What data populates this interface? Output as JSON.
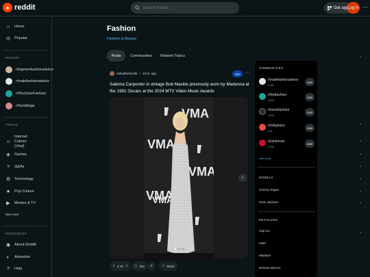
{
  "header": {
    "logo_text": "reddit",
    "search_placeholder": "Search Reddit",
    "get_app_label": "Get app",
    "login_label": "Log In",
    "more_label": "···"
  },
  "sidebar": {
    "nav": [
      {
        "label": "Home",
        "icon": "home-icon"
      },
      {
        "label": "Popular",
        "icon": "popular-icon"
      }
    ],
    "recent_label": "RECENT",
    "recent": [
      {
        "label": "r/bigmenfashionadvice",
        "color": "#c9b79c"
      },
      {
        "label": "r/malefashionadvice",
        "color": "#e6e6e6"
      },
      {
        "label": "r/PlusSizeFashion",
        "color": "#1ea79a"
      },
      {
        "label": "r/handbags",
        "color": "#d88b8b"
      }
    ],
    "topics_label": "TOPICS",
    "topics": [
      {
        "label": "Internet Culture (Viral)",
        "icon": "internet-culture-icon"
      },
      {
        "label": "Games",
        "icon": "games-icon"
      },
      {
        "label": "Q&As",
        "icon": "qa-icon"
      },
      {
        "label": "Technology",
        "icon": "technology-icon"
      },
      {
        "label": "Pop Culture",
        "icon": "pop-culture-icon"
      },
      {
        "label": "Movies & TV",
        "icon": "movies-tv-icon"
      }
    ],
    "see_more": "See more",
    "resources_label": "RESOURCES",
    "resources": [
      {
        "label": "About Reddit",
        "icon": "about-icon"
      },
      {
        "label": "Advertise",
        "icon": "advertise-icon"
      },
      {
        "label": "Help",
        "icon": "help-icon"
      }
    ]
  },
  "page": {
    "title": "Fashion",
    "subtitle": "Fashion & Beauty",
    "tabs": [
      "Posts",
      "Communities",
      "Related Topics"
    ]
  },
  "post": {
    "author": "r/whatthefrockk",
    "age": "10 hr. ago",
    "join_label": "Join",
    "more_label": "···",
    "title": "Sabrina Carpenter in vintage Bob Mackie previously worn by Madonna at the 1991 Oscars at the 2024 MTV Video Music Awards",
    "upvotes": "2.7K",
    "comments": "282",
    "share_label": "Share",
    "image_text": "VMA"
  },
  "right": {
    "communities_label": "COMMUNITIES",
    "communities": [
      {
        "name": "r/malefashionadvice",
        "count": "5.6M",
        "color": "#e6e6e6"
      },
      {
        "name": "r/findfashion",
        "count": "364K",
        "color": "#1ea79a"
      },
      {
        "name": "r/mensfashion",
        "count": "225K",
        "color": "#2b2b2b"
      },
      {
        "name": "r/mtfashion",
        "count": "18K",
        "color": "#e94b3c"
      },
      {
        "name": "r/lululemon",
        "count": "576K",
        "color": "#c8102e"
      }
    ],
    "join_label": "Join",
    "see_more": "See more",
    "models_label": "MODELS",
    "models": [
      "Chrissy Teigen",
      "Paris Jackson"
    ],
    "retailers_label": "RETAILERS",
    "retailers": [
      "Gap Inc.",
      "H&M",
      "Madalan",
      "Neiman Marcus"
    ]
  }
}
